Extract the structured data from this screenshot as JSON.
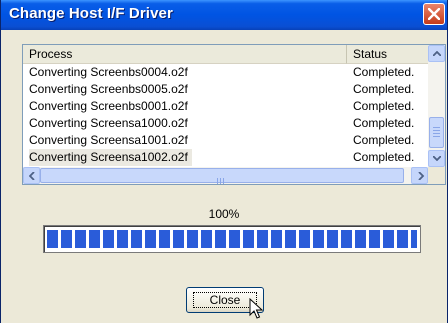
{
  "window": {
    "title": "Change Host I/F Driver"
  },
  "list": {
    "columns": {
      "process": "Process",
      "status": "Status"
    },
    "rows": [
      {
        "process": "Converting Screenbs0004.o2f",
        "status": "Completed."
      },
      {
        "process": "Converting Screenbs0005.o2f",
        "status": "Completed."
      },
      {
        "process": "Converting Screenbs0001.o2f",
        "status": "Completed."
      },
      {
        "process": "Converting Screensa1000.o2f",
        "status": "Completed."
      },
      {
        "process": "Converting Screensa1001.o2f",
        "status": "Completed."
      },
      {
        "process": "Converting Screensa1002.o2f",
        "status": "Completed."
      }
    ],
    "selected_row": 5
  },
  "progress": {
    "label": "100%",
    "fraction": 1.0
  },
  "close_button": {
    "label": "Close"
  },
  "colors": {
    "titlebar": "#0054e3",
    "progress_fill": "#2a5cd9",
    "close_x": "#c43b1a"
  },
  "icons": [
    "close-icon",
    "scroll-up-icon",
    "scroll-down-icon",
    "scroll-left-icon",
    "scroll-right-icon",
    "mouse-cursor-icon"
  ]
}
